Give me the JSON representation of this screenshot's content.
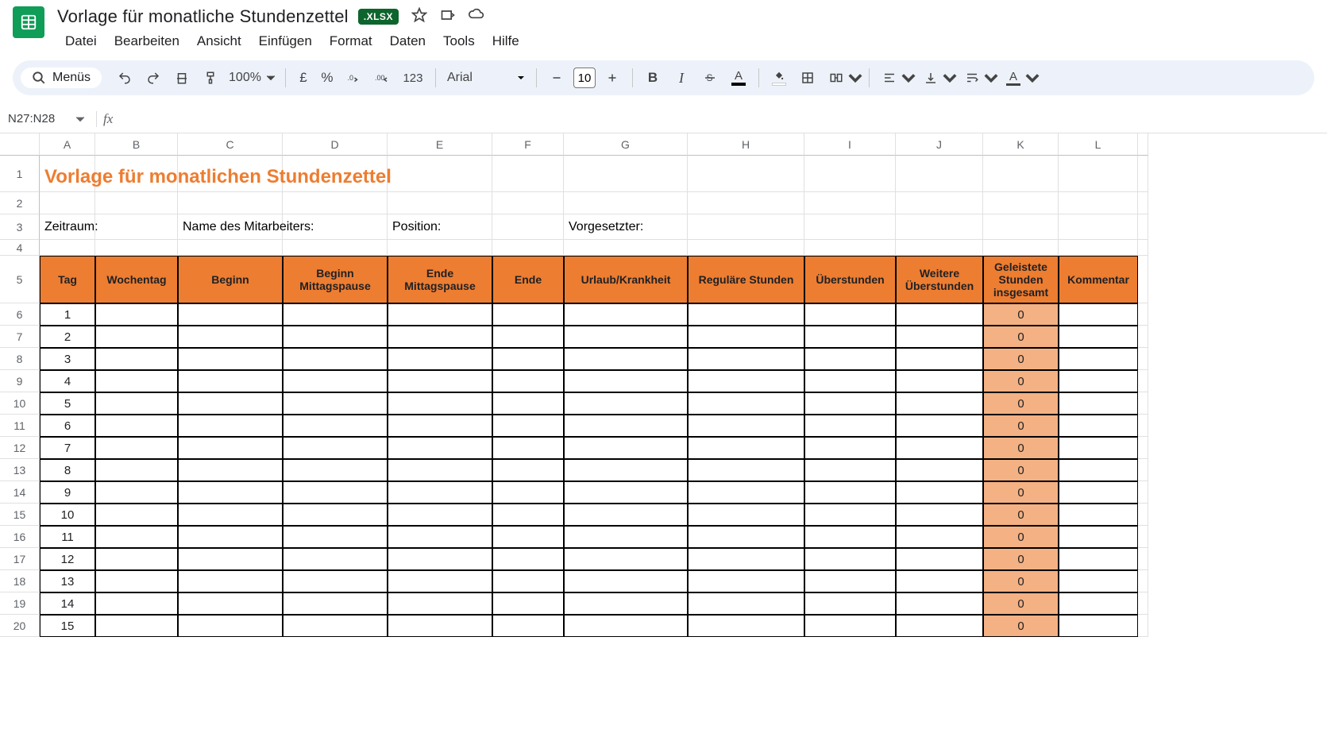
{
  "doc": {
    "title": "Vorlage für monatliche Stundenzettel",
    "badge": ".XLSX"
  },
  "menus": [
    "Datei",
    "Bearbeiten",
    "Ansicht",
    "Einfügen",
    "Format",
    "Daten",
    "Tools",
    "Hilfe"
  ],
  "toolbar": {
    "menus_label": "Menüs",
    "zoom": "100%",
    "currency": "£",
    "percent": "%",
    "numfmt": "123",
    "font": "Arial",
    "font_size": "10"
  },
  "namebox": "N27:N28",
  "formula": "",
  "columns": [
    "A",
    "B",
    "C",
    "D",
    "E",
    "F",
    "G",
    "H",
    "I",
    "J",
    "K",
    "L"
  ],
  "row_numbers": [
    1,
    2,
    3,
    4,
    5,
    6,
    7,
    8,
    9,
    10,
    11,
    12,
    13,
    14,
    15,
    16,
    17,
    18,
    19,
    20
  ],
  "sheet": {
    "title": "Vorlage für monatlichen Stundenzettel",
    "labels": {
      "period": "Zeitraum:",
      "employee": "Name des Mitarbeiters:",
      "position": "Position:",
      "manager": "Vorgesetzter:"
    },
    "headers": [
      "Tag",
      "Wochentag",
      "Beginn",
      "Beginn Mittagspause",
      "Ende Mittagspause",
      "Ende",
      "Urlaub/Krankheit",
      "Reguläre Stunden",
      "Überstunden",
      "Weitere Überstunden",
      "Geleistete Stunden insgesamt",
      "Kommentar"
    ],
    "rows": [
      {
        "day": "1",
        "total": "0"
      },
      {
        "day": "2",
        "total": "0"
      },
      {
        "day": "3",
        "total": "0"
      },
      {
        "day": "4",
        "total": "0"
      },
      {
        "day": "5",
        "total": "0"
      },
      {
        "day": "6",
        "total": "0"
      },
      {
        "day": "7",
        "total": "0"
      },
      {
        "day": "8",
        "total": "0"
      },
      {
        "day": "9",
        "total": "0"
      },
      {
        "day": "10",
        "total": "0"
      },
      {
        "day": "11",
        "total": "0"
      },
      {
        "day": "12",
        "total": "0"
      },
      {
        "day": "13",
        "total": "0"
      },
      {
        "day": "14",
        "total": "0"
      },
      {
        "day": "15",
        "total": "0"
      }
    ]
  }
}
